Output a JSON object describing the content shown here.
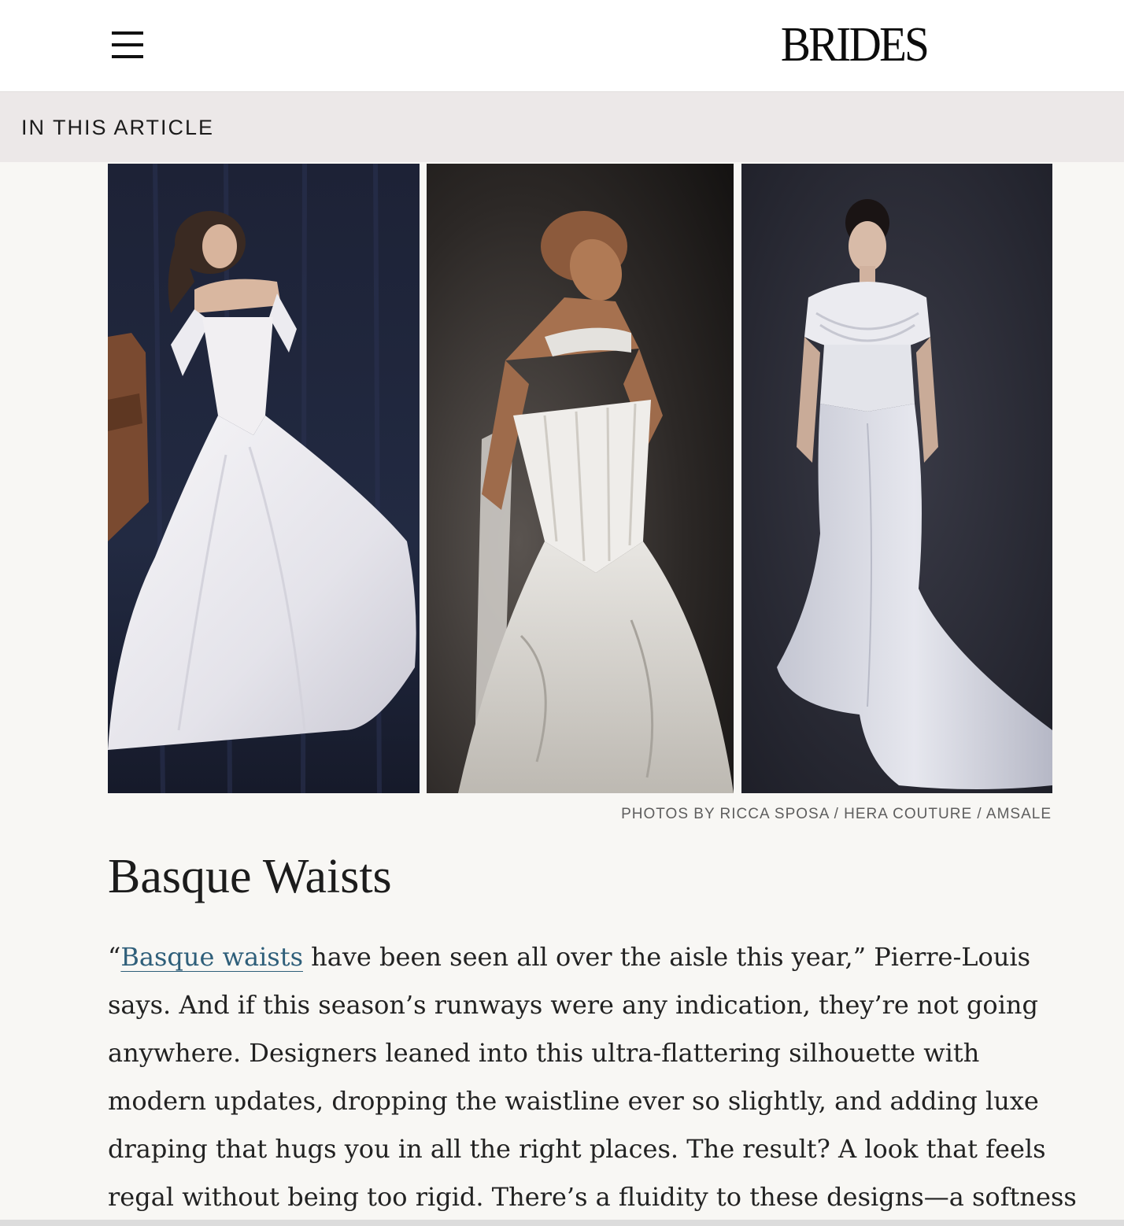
{
  "header": {
    "logo_text": "BRIDES",
    "menu_icon": "hamburger-menu-icon"
  },
  "toc": {
    "label": "IN THIS ARTICLE"
  },
  "gallery": {
    "photos": [
      {
        "subject": "ball-gown-bride-photo"
      },
      {
        "subject": "corset-gown-bride-photo"
      },
      {
        "subject": "draped-sheath-bride-photo"
      }
    ],
    "caption": "PHOTOS BY RICCA SPOSA / HERA COUTURE / AMSALE"
  },
  "article": {
    "heading": "Basque Waists",
    "para_open_quote": "“",
    "para_link": "Basque waists",
    "para_line1_rest": " have been seen all over the aisle this year,” Pierre-Louis",
    "para_line2": "says. And if this season’s runways were any indication, they’re not going",
    "para_line3": "anywhere. Designers leaned into this ultra-flattering silhouette with",
    "para_line4": "modern updates, dropping the waistline ever so slightly, and adding luxe",
    "para_line5": "draping that hugs you in all the right places. The result? A look that feels",
    "para_line6": "regal without being too rigid. There’s a fluidity to these designs—a softness"
  },
  "colors": {
    "page_bg": "#f8f7f4",
    "toc_bg": "#ece8e8",
    "link": "#2f5f7a",
    "text": "#222222"
  }
}
